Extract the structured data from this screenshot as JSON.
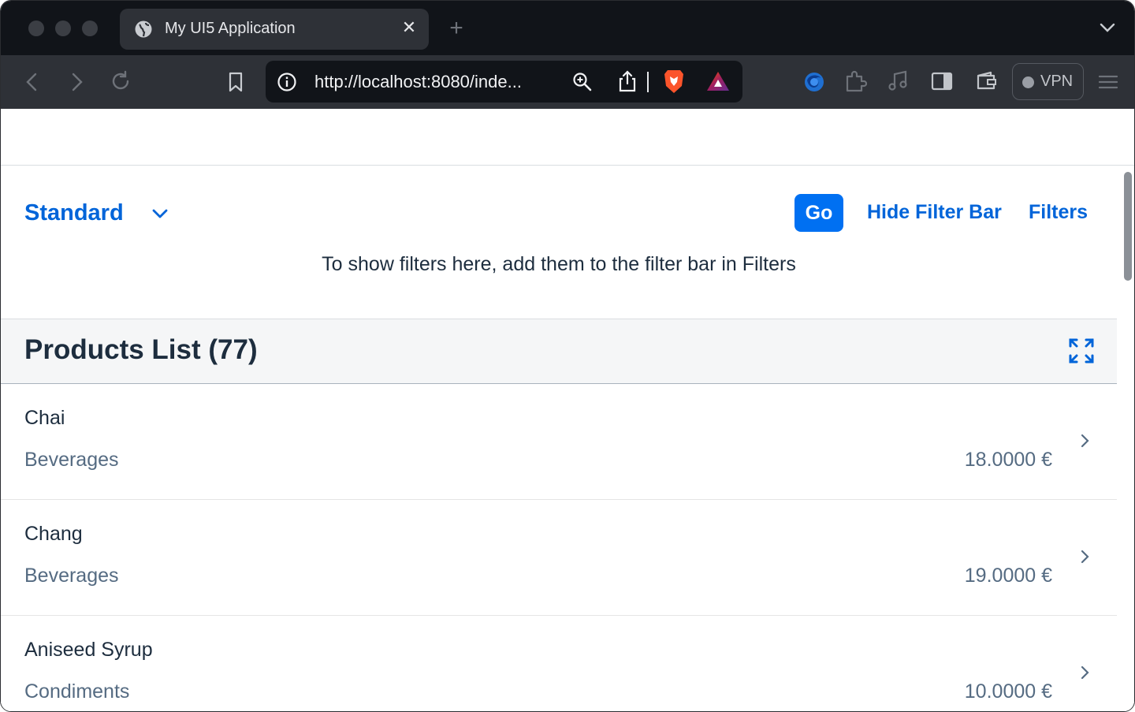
{
  "browser": {
    "tab_title": "My UI5 Application",
    "tab_close": "✕",
    "new_tab": "+",
    "url": "http://localhost:8080/inde...",
    "vpn_label": "VPN"
  },
  "filterbar": {
    "variant": "Standard",
    "go_label": "Go",
    "hide_label": "Hide Filter Bar",
    "filters_label": "Filters",
    "hint": "To show filters here, add them to the filter bar in Filters"
  },
  "list": {
    "title": "Products List (77)",
    "items": [
      {
        "name": "Chai",
        "category": "Beverages",
        "price": "18.0000 €"
      },
      {
        "name": "Chang",
        "category": "Beverages",
        "price": "19.0000 €"
      },
      {
        "name": "Aniseed Syrup",
        "category": "Condiments",
        "price": "10.0000 €"
      }
    ]
  },
  "colors": {
    "accent": "#0064d9",
    "button": "#0070f2",
    "title_text": "#1d2d3e",
    "secondary_text": "#556b82",
    "header_bg": "#f5f6f7"
  }
}
